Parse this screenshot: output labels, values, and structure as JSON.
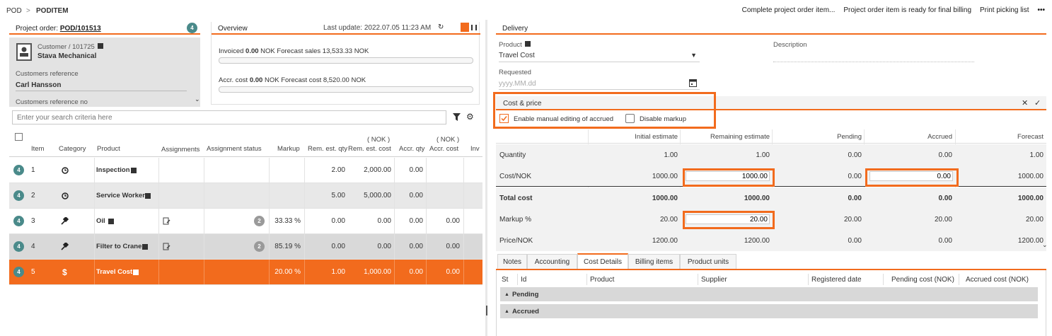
{
  "breadcrumb": {
    "root": "POD",
    "separator": ">",
    "current": "PODITEM"
  },
  "toolbar": {
    "complete": "Complete project order item...",
    "ready": "Project order item is ready for final billing",
    "print": "Print picking list",
    "more": "•••"
  },
  "project_order": {
    "label": "Project order:",
    "number": "POD/101513",
    "badge": "4",
    "customer_label": "Customer / 101725",
    "customer_name": "Stava Mechanical",
    "customers_reference_label": "Customers reference",
    "customers_reference_value": "Carl Hansson",
    "customers_reference_no_label": "Customers reference no"
  },
  "overview": {
    "title": "Overview",
    "last_update": "Last update: 2022.07.05 11:23 AM",
    "invoiced_label": "Invoiced",
    "invoiced_value": "0.00",
    "invoiced_rest": "NOK Forecast sales 13,533.33 NOK",
    "accr_label": "Accr. cost",
    "accr_value": "0.00",
    "accr_rest": "NOK Forecast cost 8,520.00 NOK"
  },
  "search": {
    "placeholder": "Enter your search criteria here"
  },
  "grid": {
    "headers": {
      "item": "Item",
      "category": "Category",
      "product": "Product",
      "assignments": "Assignments",
      "assignment_status": "Assignment status",
      "markup": "Markup",
      "rem_qty": "Rem. est. qty",
      "rem_cost_unit": "( NOK )",
      "rem_cost": "Rem. est. cost",
      "accr_qty": "Accr. qty",
      "accr_cost_unit": "( NOK )",
      "accr_cost": "Accr. cost",
      "inv": "Inv"
    },
    "rows": [
      {
        "badge": "4",
        "item": "1",
        "product": "Inspection",
        "status_badge": "",
        "markup": "",
        "rem_qty": "2.00",
        "rem_cost": "2,000.00",
        "accr_qty": "0.00",
        "accr_cost": ""
      },
      {
        "badge": "4",
        "item": "2",
        "product": "Service Worker",
        "status_badge": "",
        "markup": "",
        "rem_qty": "5.00",
        "rem_cost": "5,000.00",
        "accr_qty": "0.00",
        "accr_cost": ""
      },
      {
        "badge": "4",
        "item": "3",
        "product": "Oil",
        "status_badge": "2",
        "markup": "33.33 %",
        "rem_qty": "0.00",
        "rem_cost": "0.00",
        "accr_qty": "0.00",
        "accr_cost": "0.00"
      },
      {
        "badge": "4",
        "item": "4",
        "product": "Filter to Crane",
        "status_badge": "2",
        "markup": "85.19 %",
        "rem_qty": "0.00",
        "rem_cost": "0.00",
        "accr_qty": "0.00",
        "accr_cost": "0.00"
      },
      {
        "badge": "4",
        "item": "5",
        "product": "Travel Cost",
        "status_badge": "",
        "markup": "20.00 %",
        "rem_qty": "1.00",
        "rem_cost": "1,000.00",
        "accr_qty": "0.00",
        "accr_cost": "0.00"
      }
    ]
  },
  "delivery": {
    "title": "Delivery",
    "product_label": "Product",
    "product_value": "Travel Cost",
    "description_label": "Description",
    "requested_label": "Requested",
    "requested_placeholder": "yyyy.MM.dd"
  },
  "cost_price": {
    "title": "Cost & price",
    "enable_manual": "Enable manual editing of accrued",
    "disable_markup": "Disable markup",
    "columns": [
      "Initial estimate",
      "Remaining estimate",
      "Pending",
      "Accrued",
      "Forecast"
    ],
    "rows": [
      {
        "label": "Quantity",
        "values": [
          "1.00",
          "1.00",
          "0.00",
          "0.00",
          "1.00"
        ]
      },
      {
        "label": "Cost/NOK",
        "values": [
          "1000.00",
          "1000.00",
          "0.00",
          "0.00",
          "1000.00"
        ]
      },
      {
        "label": "Total cost",
        "values": [
          "1000.00",
          "1000.00",
          "0.00",
          "0.00",
          "1000.00"
        ]
      },
      {
        "label": "Markup %",
        "values": [
          "20.00",
          "20.00",
          "20.00",
          "20.00",
          "20.00"
        ]
      },
      {
        "label": "Price/NOK",
        "values": [
          "1200.00",
          "1200.00",
          "0.00",
          "0.00",
          "1200.00"
        ]
      }
    ]
  },
  "tabs": [
    "Notes",
    "Accounting",
    "Cost Details",
    "Billing items",
    "Product units"
  ],
  "cost_details": {
    "headers": [
      "St",
      "Id",
      "Product",
      "Supplier",
      "Registered date",
      "Pending cost (NOK)",
      "Accrued cost (NOK)"
    ],
    "groups": [
      "Pending",
      "Accrued"
    ]
  },
  "colors": {
    "accent": "#f26b1d",
    "badge": "#4a8a8a"
  }
}
